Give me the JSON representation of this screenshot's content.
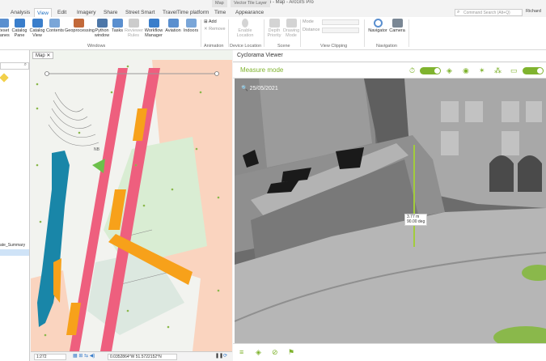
{
  "window": {
    "title": "CycloMedia demo - Map - ArcGIS Pro",
    "context_tabs": [
      {
        "group": "Map",
        "tab": "Time"
      },
      {
        "group": "Vector Tile Layer",
        "tab": "Appearance"
      }
    ]
  },
  "tabs": [
    "Analysis",
    "View",
    "Edit",
    "Imagery",
    "Share",
    "Street Smart",
    "TravelTime platform",
    "Time",
    "Appearance"
  ],
  "active_tab": "View",
  "search": {
    "placeholder": "Command Search (Alt+Q)"
  },
  "user": "Richard",
  "ribbon": {
    "windows_buttons": [
      "Reset Panes",
      "Catalog Pane",
      "Catalog View",
      "Contents",
      "Geoprocessing",
      "Python window",
      "Tasks",
      "Reviewer Rules",
      "Workflow Manager",
      "Aviation",
      "Indoors"
    ],
    "animation_buttons": [
      "Add",
      "Remove"
    ],
    "device_location_buttons": [
      "Enable Location"
    ],
    "scene_buttons": [
      "Depth Priority",
      "Drawing Mode"
    ],
    "view_clipping_fields": [
      "Mode",
      "Distance"
    ],
    "navigation_buttons": [
      "Navigator",
      "Camera"
    ],
    "groups": [
      "Windows",
      "Animation",
      "Device Location",
      "Scene",
      "View Clipping",
      "Navigation"
    ]
  },
  "contents": {
    "selected_layer": "ate_Summary"
  },
  "map": {
    "tab_label": "Map",
    "scale": "1:272",
    "coordinates": "0.0352864°W 51.5722152°N",
    "street_label": "NB"
  },
  "cyclorama": {
    "title": "Cyclorama Viewer",
    "mode": "Measure mode",
    "date": "25/05/2021",
    "measurement": {
      "height": "3.77 m",
      "angle": "90.00 deg"
    }
  },
  "colors": {
    "accent_green": "#7fb32e",
    "road_pink": "#ee5f7e",
    "footway_orange": "#f7a11a",
    "water_teal": "#1986a8"
  }
}
